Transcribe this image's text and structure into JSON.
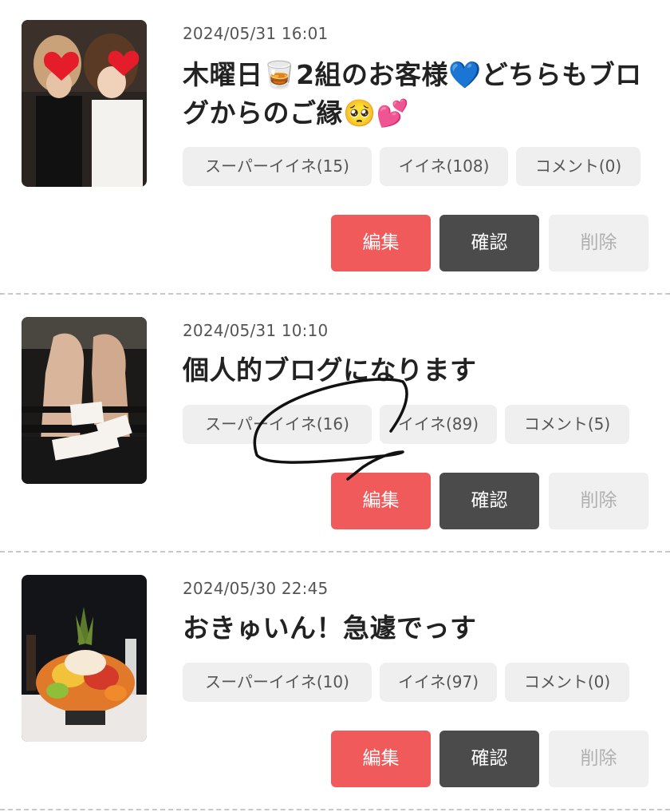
{
  "posts": [
    {
      "date": "2024/05/31 16:01",
      "title": "木曜日🥃2組のお客様💙どちらもブログからのご縁🥺💕",
      "super_like": "スーパーイイネ(15)",
      "like": "イイネ(108)",
      "comment": "コメント(0)",
      "edit": "編集",
      "confirm": "確認",
      "delete": "削除"
    },
    {
      "date": "2024/05/31 10:10",
      "title": "個人的ブログになります",
      "super_like": "スーパーイイネ(16)",
      "like": "イイネ(89)",
      "comment": "コメント(5)",
      "edit": "編集",
      "confirm": "確認",
      "delete": "削除"
    },
    {
      "date": "2024/05/30 22:45",
      "title": "おきゅいん！急遽でっす",
      "super_like": "スーパーイイネ(10)",
      "like": "イイネ(97)",
      "comment": "コメント(0)",
      "edit": "編集",
      "confirm": "確認",
      "delete": "削除"
    }
  ],
  "colors": {
    "edit_button": "#f05a5a",
    "confirm_button": "#4b4b4b",
    "delete_button": "#f0f0f0",
    "chip": "#efefef"
  }
}
